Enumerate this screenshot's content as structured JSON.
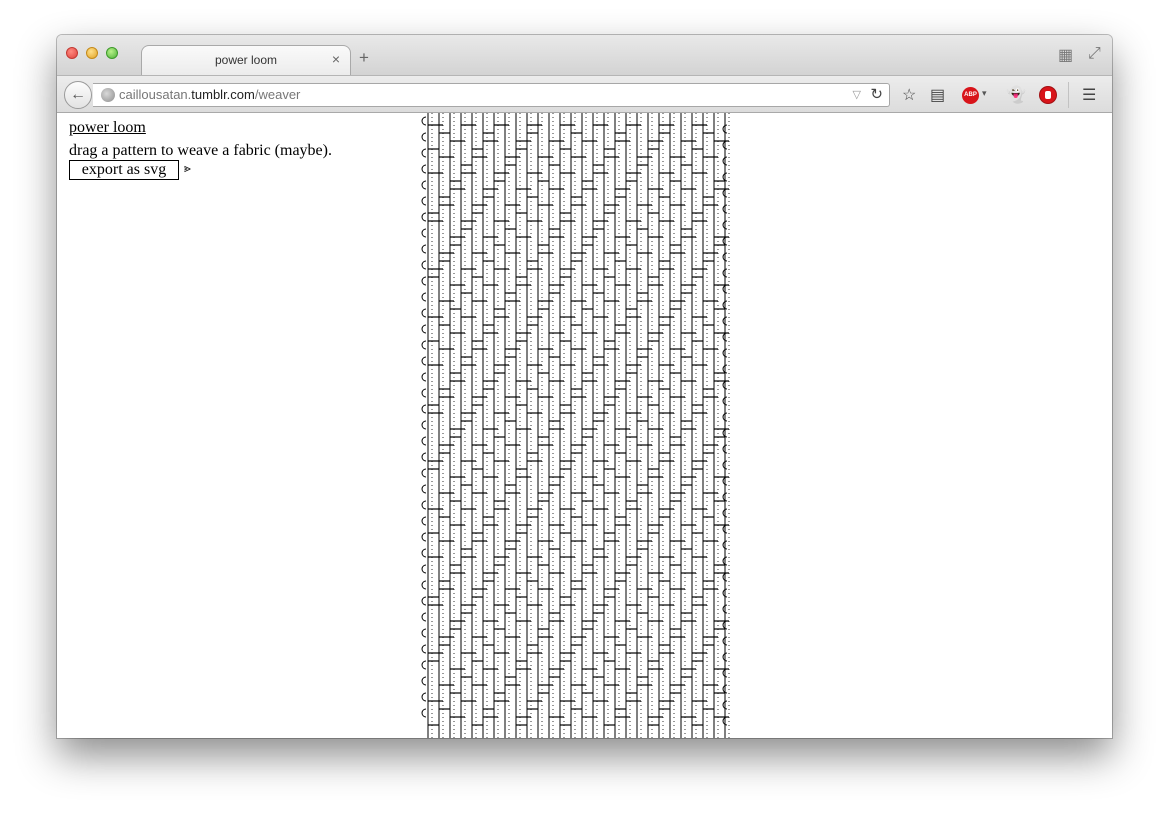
{
  "browser": {
    "tab": {
      "title": "power loom",
      "close_glyph": "×"
    },
    "new_tab_glyph": "+",
    "url": {
      "prefix": "caillousatan.",
      "host": "tumblr.com",
      "path": "/weaver"
    },
    "toolbar_icons": [
      "back-icon",
      "site-identity-icon",
      "reload-icon",
      "bookmark-star-icon",
      "reading-list-icon",
      "adblock-plus-icon",
      "ghostery-icon",
      "stop-icon",
      "menu-icon"
    ],
    "abp_label": "ABP"
  },
  "page": {
    "title": "power loom",
    "description": "drag a pattern to weave a fabric (maybe).",
    "export_label": "export as svg",
    "glyph": "⪢"
  },
  "loom": {
    "warp_threads": 28,
    "weft_rows": 38,
    "thread_color": "#000000",
    "selvedge_left_glyph": "⊂",
    "selvedge_right_glyph": "⊃"
  }
}
